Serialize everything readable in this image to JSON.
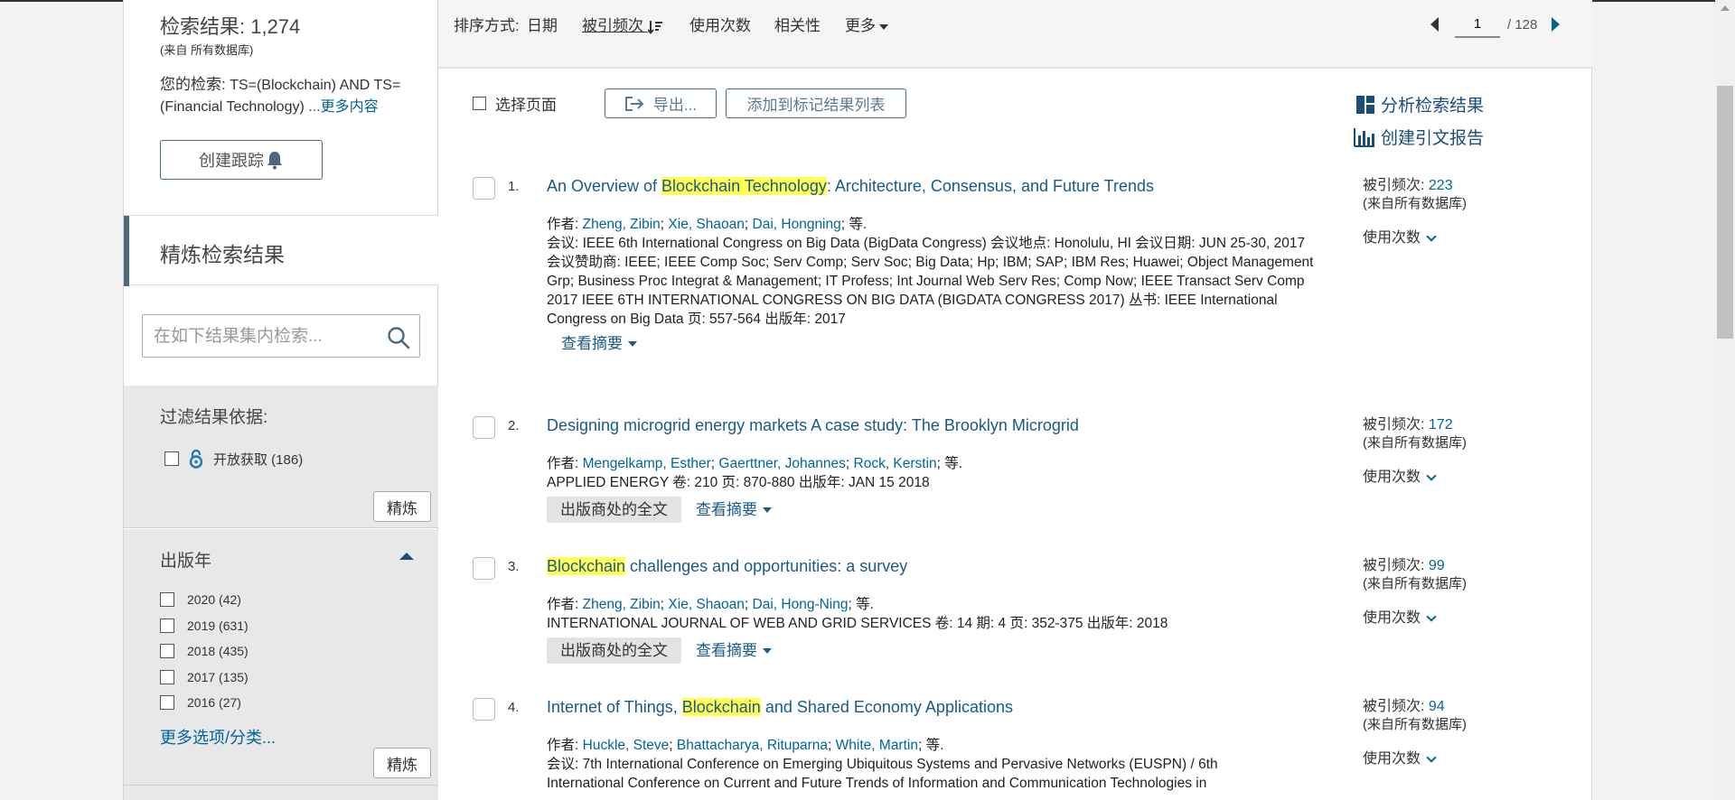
{
  "sidebar": {
    "result_title": "检索结果: 1,274",
    "result_source": "(来自 所有数据库)",
    "query_label": "您的检索:",
    "query_text": "TS=(Blockchain) AND TS=(Financial Technology)",
    "query_more": "...更多内容",
    "track_button": "创建跟踪",
    "refine_heading": "精炼检索结果",
    "search_placeholder": "在如下结果集内检索...",
    "filter_title": "过滤结果依据:",
    "open_access_label": "开放获取 (186)",
    "refine_button": "精炼",
    "year_title": "出版年",
    "years": [
      {
        "label": "2020 (42)"
      },
      {
        "label": "2019 (631)"
      },
      {
        "label": "2018 (435)"
      },
      {
        "label": "2017 (135)"
      },
      {
        "label": "2016 (27)"
      }
    ],
    "more_options": "更多选项/分类..."
  },
  "sortbar": {
    "label": "排序方式:",
    "items": [
      "日期",
      "被引频次",
      "使用次数",
      "相关性",
      "更多"
    ],
    "page_current": "1",
    "page_total": "/ 128"
  },
  "toolbar": {
    "select_page": "选择页面",
    "export": "导出...",
    "add_marked": "添加到标记结果列表",
    "analyze": "分析检索结果",
    "citation_report": "创建引文报告"
  },
  "labels": {
    "authors_prefix": "作者:",
    "etal": "; 等.",
    "cited_prefix": "被引频次:",
    "cited_source": "(来自所有数据库)",
    "usage": "使用次数",
    "abstract": "查看摘要",
    "fulltext": "出版商处的全文"
  },
  "records": [
    {
      "num": "1.",
      "title_parts": [
        "An Overview of ",
        "Blockchain Technology",
        ": Architecture, Consensus, and Future Trends"
      ],
      "authors": [
        "Zheng, Zibin",
        "Xie, Shaoan",
        "Dai, Hongning"
      ],
      "line1": "会议: IEEE 6th International Congress on Big Data (BigData Congress) 会议地点: Honolulu, HI 会议日期: JUN 25-30, 2017",
      "line2": "会议赞助商: IEEE; IEEE Comp Soc; Serv Comp; Serv Soc; Big Data; Hp; IBM; SAP; IBM Res; Huawei; Object Management Grp; Business Proc Integrat & Management; IT Profess; Int Journal Web Serv Res; Comp Now; IEEE Transact Serv Comp",
      "line3": "2017 IEEE 6TH INTERNATIONAL CONGRESS ON BIG DATA (BIGDATA CONGRESS 2017) 丛书: IEEE International Congress on Big Data   页: 557-564   出版年: 2017",
      "cited": "223"
    },
    {
      "num": "2.",
      "title_parts": [
        "Designing microgrid energy markets A case study: The Brooklyn Microgrid",
        "",
        ""
      ],
      "authors": [
        "Mengelkamp, Esther",
        "Gaerttner, Johannes",
        "Rock, Kerstin"
      ],
      "line1": "APPLIED ENERGY  卷: 210   页: 870-880   出版年: JAN 15 2018",
      "cited": "172"
    },
    {
      "num": "3.",
      "title_parts": [
        "",
        "Blockchain",
        " challenges and opportunities: a survey"
      ],
      "authors": [
        "Zheng, Zibin",
        "Xie, Shaoan",
        "Dai, Hong-Ning"
      ],
      "line1": "INTERNATIONAL JOURNAL OF WEB AND GRID SERVICES  卷: 14   期: 4   页: 352-375   出版年: 2018",
      "cited": "99"
    },
    {
      "num": "4.",
      "title_parts": [
        "Internet of Things, ",
        "Blockchain",
        " and Shared Economy Applications"
      ],
      "authors": [
        "Huckle, Steve",
        "Bhattacharya, Rituparna",
        "White, Martin"
      ],
      "line1": "会议: 7th International Conference on Emerging Ubiquitous Systems and Pervasive Networks (EUSPN) / 6th",
      "line2": "International Conference on Current and Future Trends of Information and Communication Technologies in",
      "cited": "94"
    }
  ],
  "colors": {
    "link": "#006598",
    "highlight": "#ffff55",
    "accent_bar": "#4a6a82"
  }
}
